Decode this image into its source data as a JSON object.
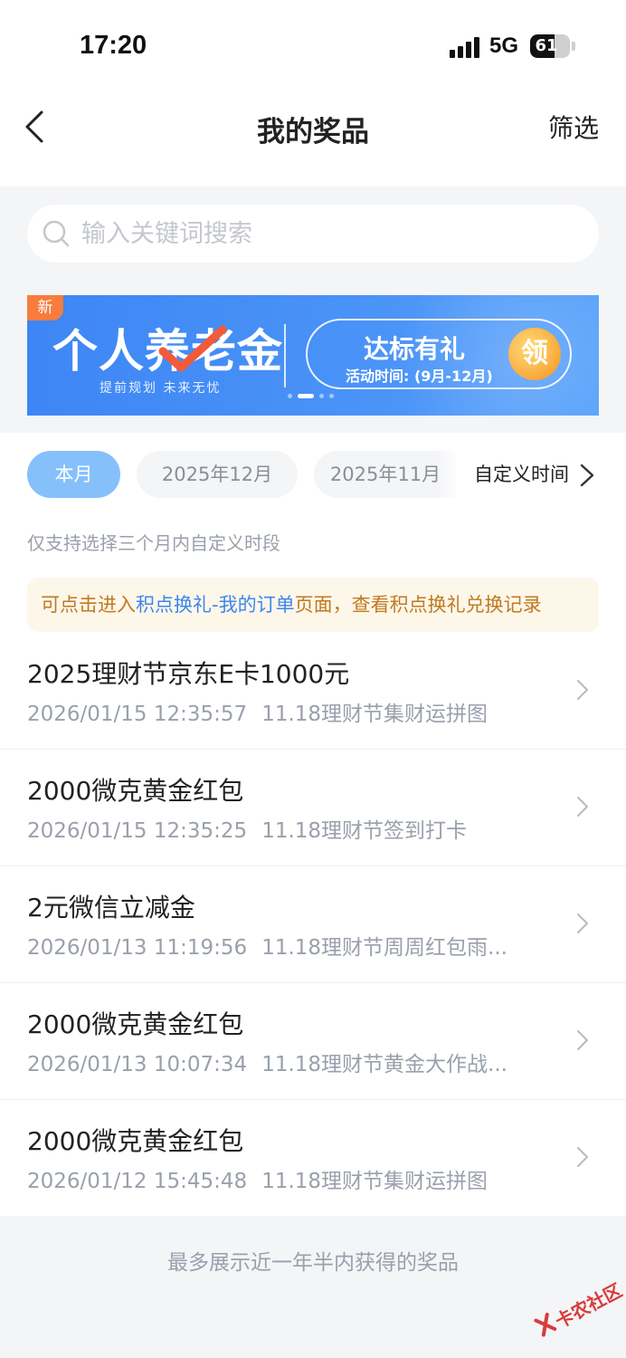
{
  "status_bar": {
    "time": "17:20",
    "network": "5G",
    "battery": "61",
    "battery_level": 0.61
  },
  "nav": {
    "title": "我的奖品",
    "filter_label": "筛选"
  },
  "search": {
    "placeholder": "输入关键词搜索"
  },
  "banner": {
    "badge": "新",
    "title": "个人养老金",
    "subtitle": "提前规划   未来无忧",
    "cta": "达标有礼",
    "activity_time": "活动时间: (9月-12月)",
    "claim": "领",
    "slide_count": 4,
    "active_slide": 1
  },
  "date_filter": {
    "chips": [
      "本月",
      "2025年12月",
      "2025年11月"
    ],
    "selected": "本月",
    "custom_label": "自定义时间",
    "hint": "仅支持选择三个月内自定义时段"
  },
  "notice": {
    "prefix": "可点击进入",
    "link": "积点换礼-我的订单",
    "suffix": "页面，查看积点换礼兑换记录"
  },
  "prizes": [
    {
      "title": "2025理财节京东E卡1000元",
      "time": "2026/01/15 12:35:57",
      "source": "11.18理财节集财运拼图"
    },
    {
      "title": "2000微克黄金红包",
      "time": "2026/01/15 12:35:25",
      "source": "11.18理财节签到打卡"
    },
    {
      "title": "2元微信立减金",
      "time": "2026/01/13 11:19:56",
      "source": "11.18理财节周周红包雨..."
    },
    {
      "title": "2000微克黄金红包",
      "time": "2026/01/13 10:07:34",
      "source": "11.18理财节黄金大作战..."
    },
    {
      "title": "2000微克黄金红包",
      "time": "2026/01/12 15:45:48",
      "source": "11.18理财节集财运拼图"
    }
  ],
  "footer": {
    "note": "最多展示近一年半内获得的奖品"
  },
  "watermark": {
    "text": "卡农社区"
  },
  "colors": {
    "accent": "#85c0fb",
    "link": "#3c86ee",
    "notice_text": "#c07a1f",
    "notice_bg": "#fdf7ea",
    "banner_blue": "#3e86f5"
  }
}
